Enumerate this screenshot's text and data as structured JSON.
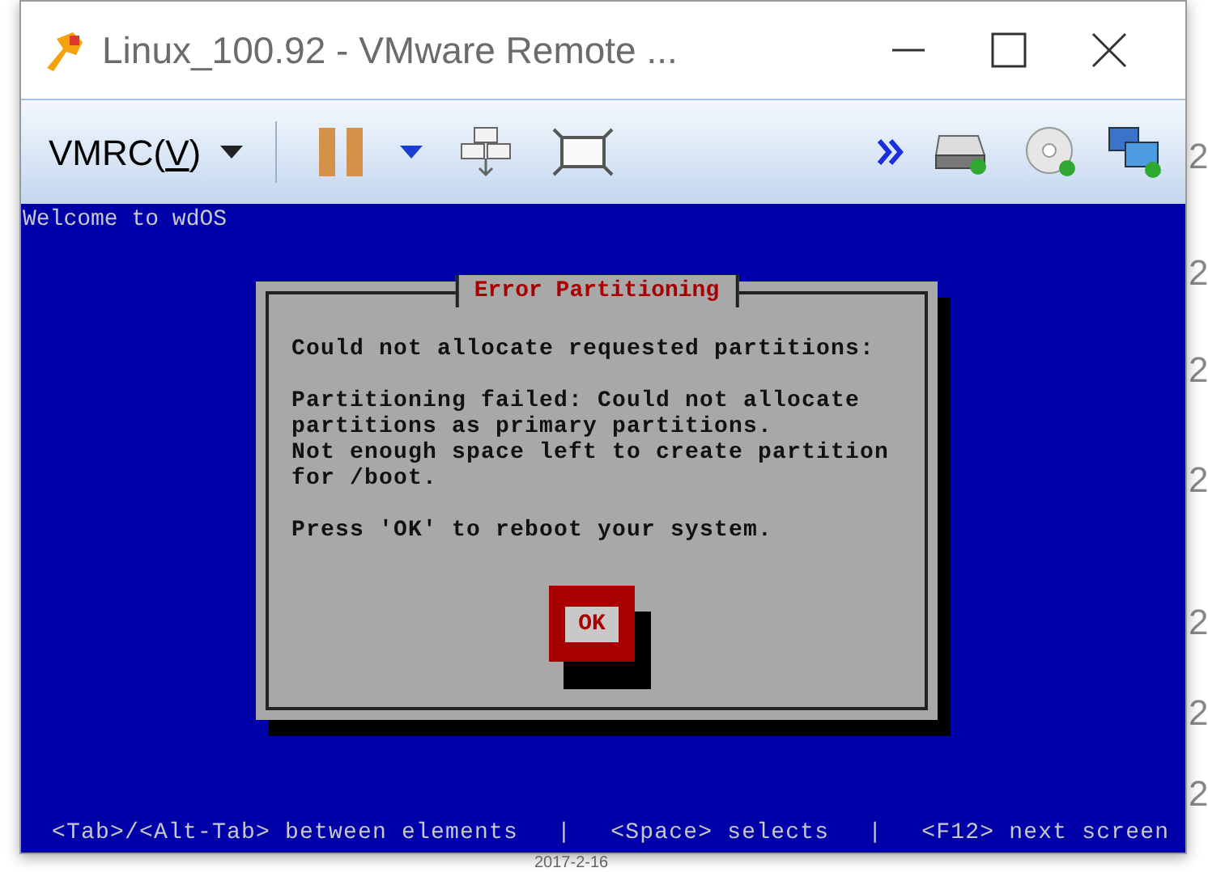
{
  "background": {
    "column_cells": [
      "2",
      "2",
      "2",
      "2",
      "2",
      "2",
      "2"
    ],
    "date_cell": "2017-2-16"
  },
  "window": {
    "title": "Linux_100.92 - VMware Remote ..."
  },
  "toolbar": {
    "menu_label": [
      {
        "text": "VMRC(",
        "underlined": false
      },
      {
        "text": "V",
        "underlined": true
      },
      {
        "text": ")",
        "underlined": false
      }
    ]
  },
  "console": {
    "welcome": "Welcome to wdOS",
    "dialog": {
      "title": "Error Partitioning",
      "paragraphs": [
        [
          "Could not allocate requested partitions:"
        ],
        [
          "Partitioning failed: Could not allocate",
          "partitions as primary partitions.",
          "Not enough space left to create partition",
          "for /boot."
        ],
        [
          "Press 'OK' to reboot your system."
        ]
      ],
      "button": {
        "label": "OK",
        "selected": true
      }
    },
    "help_bar": [
      "<Tab>/<Alt-Tab> between elements",
      "|",
      "<Space> selects",
      "|",
      "<F12> next screen"
    ]
  }
}
